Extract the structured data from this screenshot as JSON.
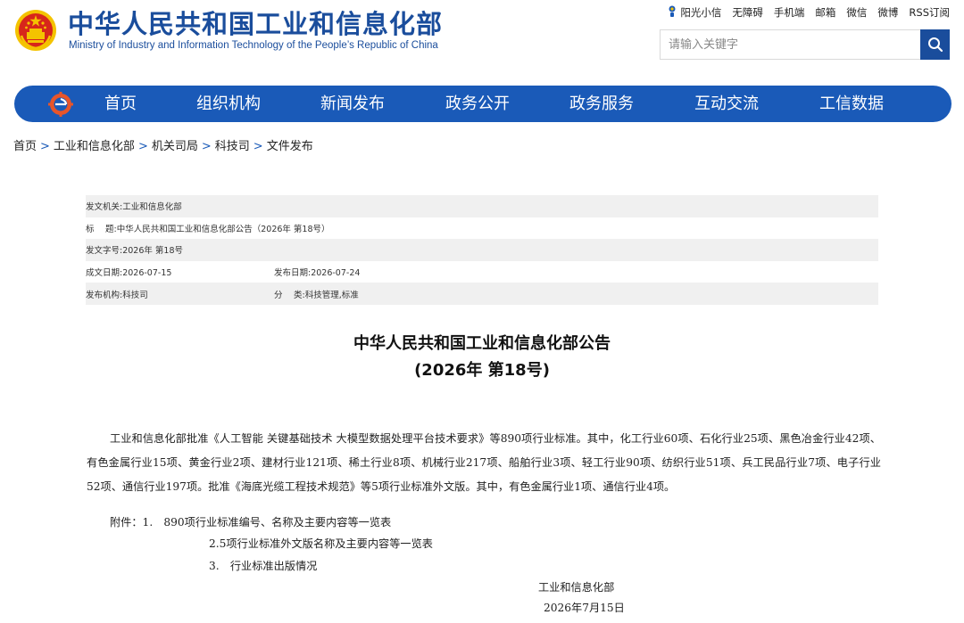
{
  "header": {
    "title": "中华人民共和国工业和信息化部",
    "subtitle": "Ministry of Industry and Information Technology of the People’s Republic of China",
    "top_links": [
      "阳光小信",
      "无障碍",
      "手机端",
      "邮箱",
      "微信",
      "微博",
      "RSS订阅"
    ],
    "search_placeholder": "请输入关键字"
  },
  "nav": {
    "items": [
      "首页",
      "组织机构",
      "新闻发布",
      "政务公开",
      "政务服务",
      "互动交流",
      "工信数据"
    ]
  },
  "breadcrumb": [
    "首页",
    "工业和信息化部",
    "机关司局",
    "科技司",
    "文件发布"
  ],
  "meta": {
    "issuer_label": "发文机关:",
    "issuer": "工业和信息化部",
    "title_label": "标　 题:",
    "title": "中华人民共和国工业和信息化部公告（2026年 第18号）",
    "doc_no_label": "发文字号:",
    "doc_no": "2026年 第18号",
    "date_label": "成文日期:",
    "date": "2026-07-15",
    "publish_label": "发布日期:",
    "publish": "2026-07-24",
    "org_label": "发布机构:",
    "org": "科技司",
    "category_label": "分　 类:",
    "category": "科技管理,标准"
  },
  "article": {
    "title_line1": "中华人民共和国工业和信息化部公告",
    "title_line2": "(2026年 第18号)",
    "body": "工业和信息化部批准《人工智能 关键基础技术 大模型数据处理平台技术要求》等890项行业标准。其中，化工行业60项、石化行业25项、黑色冶金行业42项、有色金属行业15项、黄金行业2项、建材行业121项、稀土行业8项、机械行业217项、船舶行业3项、轻工行业90项、纺织行业51项、兵工民品行业7项、电子行业52项、通信行业197项。批准《海底光缆工程技术规范》等5项行业标准外文版。其中，有色金属行业1项、通信行业4项。",
    "attach_1": "附件：1.　890项行业标准编号、名称及主要内容等一览表",
    "attach_2": "2.5项行业标准外文版名称及主要内容等一览表",
    "attach_3": "3.　行业标准出版情况",
    "signer": "工业和信息化部",
    "sign_date": "2026年7月15日"
  },
  "colors": {
    "brand_blue": "#1a4d9c",
    "nav_blue": "#1a5ab8",
    "emblem_red": "#d7261b",
    "emblem_gold": "#f4c300"
  }
}
